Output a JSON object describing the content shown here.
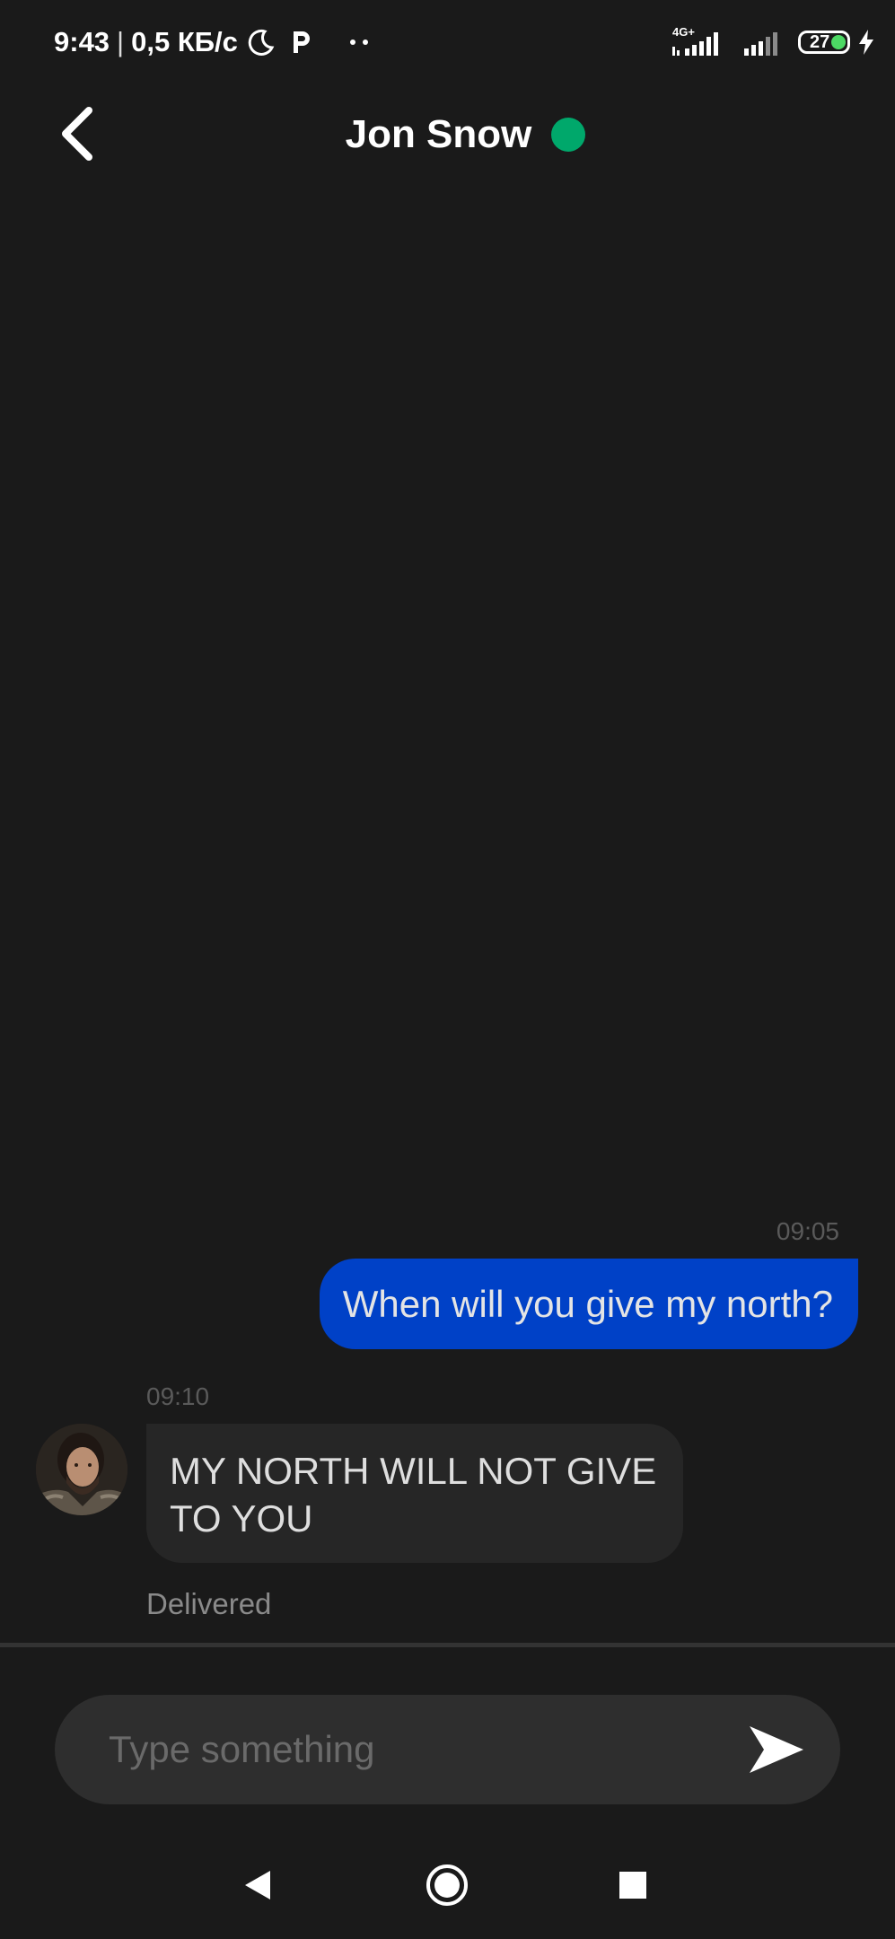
{
  "status_bar": {
    "time": "9:43",
    "separator": "|",
    "speed": "0,5 КБ/с",
    "network_label": "4G+",
    "battery_percent": "27",
    "icons": [
      "moon-icon",
      "p-icon",
      "dots-icon",
      "signal-icon",
      "battery-icon",
      "charging-icon"
    ]
  },
  "header": {
    "contact_name": "Jon Snow",
    "online_color": "#00a86b"
  },
  "messages": [
    {
      "direction": "sent",
      "time": "09:05",
      "text": "When will you give my north?"
    },
    {
      "direction": "received",
      "time": "09:10",
      "text": "MY NORTH WILL NOT GIVE TO YOU"
    }
  ],
  "delivery_status": "Delivered",
  "composer": {
    "placeholder": "Type something",
    "value": ""
  },
  "colors": {
    "background": "#1a1a1a",
    "sent_bubble": "#0041c7",
    "received_bubble": "#262626"
  }
}
